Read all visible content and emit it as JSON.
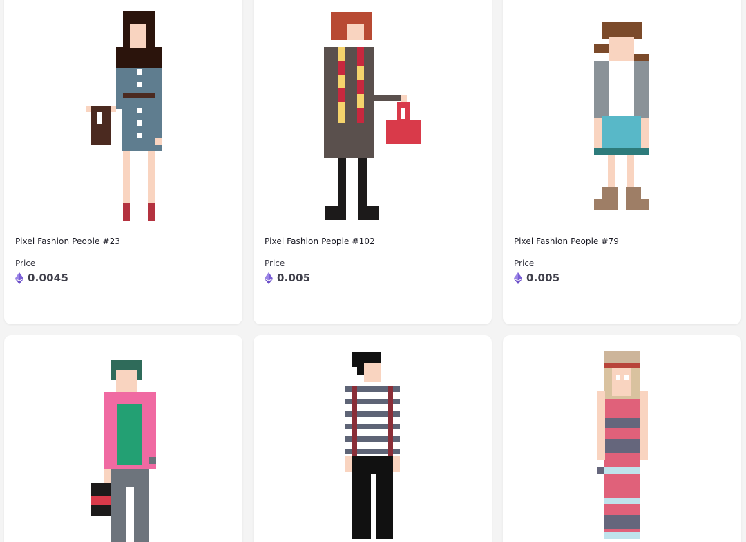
{
  "cards": [
    {
      "title": "Pixel Fashion People #23",
      "price_label": "Price",
      "price": "0.0045",
      "currency_icon": "ethereum-icon"
    },
    {
      "title": "Pixel Fashion People #102",
      "price_label": "Price",
      "price": "0.005",
      "currency_icon": "ethereum-icon"
    },
    {
      "title": "Pixel Fashion People #79",
      "price_label": "Price",
      "price": "0.005",
      "currency_icon": "ethereum-icon"
    },
    {
      "title": "",
      "price_label": "",
      "price": ""
    },
    {
      "title": "",
      "price_label": "",
      "price": ""
    },
    {
      "title": "",
      "price_label": "",
      "price": ""
    }
  ],
  "colors": {
    "page_bg": "#f4f4f4",
    "card_bg": "#ffffff",
    "eth_purple": "#7b5fd6"
  }
}
